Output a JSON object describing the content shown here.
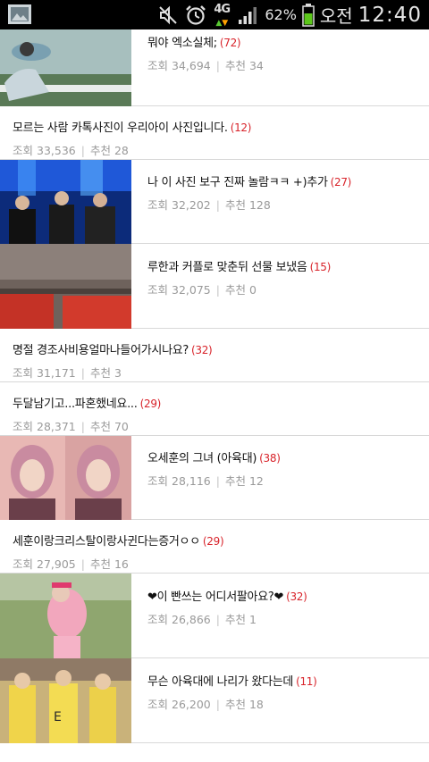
{
  "status_bar": {
    "battery_percent": "62%",
    "ampm": "오전",
    "time": "12:40",
    "network": "4G",
    "icons": [
      "gallery-icon",
      "mute-icon",
      "alarm-icon",
      "signal-icon",
      "battery-icon"
    ]
  },
  "labels": {
    "views": "조회",
    "recommends": "추천"
  },
  "posts": [
    {
      "title": "뭐야 엑소실체;",
      "comments": "(72)",
      "views": "34,694",
      "recommends": "34",
      "thumbnail": "crowd-photo"
    },
    {
      "title": "모르는 사람 카톡사진이 우리아이 사진입니다.",
      "comments": "(12)",
      "views": "33,536",
      "recommends": "28"
    },
    {
      "title": "나 이 사진 보구 진짜 놀람ㅋㅋ +)추가",
      "comments": "(27)",
      "views": "32,202",
      "recommends": "128",
      "thumbnail": "stage-photo"
    },
    {
      "title": "루한과 커플로 맞춘뒤 선물 보냈음",
      "comments": "(15)",
      "views": "32,075",
      "recommends": "0",
      "thumbnail": "red-object-photo"
    },
    {
      "title": "명절 경조사비용얼마나들어가시나요?",
      "comments": "(32)",
      "views": "31,171",
      "recommends": "3"
    },
    {
      "title": "두달남기고...파혼했네요...",
      "comments": "(29)",
      "views": "28,371",
      "recommends": "70"
    },
    {
      "title": "오세훈의 그녀 (아육대)",
      "comments": "(38)",
      "views": "28,116",
      "recommends": "12",
      "thumbnail": "pink-hair-photo"
    },
    {
      "title": "세훈이랑크리스탈이랑사귄다는증거ㅇㅇ",
      "comments": "(29)",
      "views": "27,905",
      "recommends": "16"
    },
    {
      "title": "❤이 빤쓰는 어디서팔아요?❤",
      "comments": "(32)",
      "views": "26,866",
      "recommends": "1",
      "thumbnail": "pink-outfit-photo"
    },
    {
      "title": "무슨 아육대에 나리가 왔다는데",
      "comments": "(11)",
      "views": "26,200",
      "recommends": "18",
      "thumbnail": "yellow-uniform-photo"
    }
  ],
  "colors": {
    "comment_count": "#d8232a",
    "meta_text": "#9a9a9a",
    "divider": "#d8d8d8",
    "status_bar_bg": "#000000"
  }
}
